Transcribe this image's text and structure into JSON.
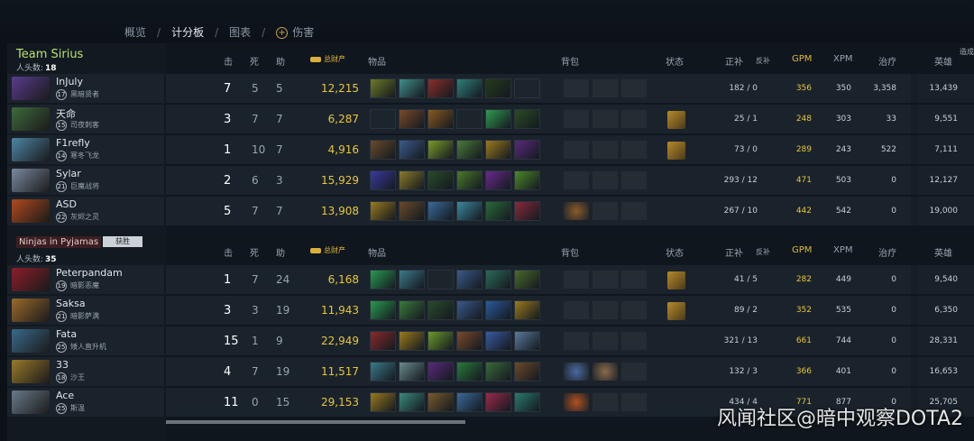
{
  "nav": {
    "tabs": [
      "概览",
      "计分板",
      "图表",
      "伤害"
    ],
    "active": "计分板",
    "sep": "/"
  },
  "headers": {
    "kills": "击",
    "deaths": "死",
    "assists": "助",
    "networth": "总财产",
    "items": "物品",
    "backpack": "背包",
    "status": "状态",
    "lasthits": "正补",
    "denies": "反补",
    "gpm": "GPM",
    "xpm": "XPM",
    "heal": "治疗",
    "hero_damage": "英雄",
    "edge": "造成"
  },
  "teams": [
    {
      "name": "Team Sirius",
      "kills_label": "人头数:",
      "kills": "18",
      "result": "",
      "players": [
        {
          "name": "InJuly",
          "level": "17",
          "hero": "黑暗贤者",
          "k": "7",
          "d": "5",
          "a": "5",
          "nw": "12,215",
          "lh": "182",
          "dn": "0",
          "gpm": "356",
          "xpm": "350",
          "heal": "3,358",
          "hd": "13,439",
          "portrait": "#5b3c8e",
          "items": [
            "#6d7a25",
            "#3f8f8a",
            "#8a2f2a",
            "#2e7f7a",
            "#243a1a",
            "empty"
          ],
          "backpack": [
            "empty",
            "empty",
            "empty"
          ],
          "neutral": ""
        },
        {
          "name": "天命",
          "level": "15",
          "hero": "司夜刺客",
          "k": "3",
          "d": "7",
          "a": "7",
          "nw": "6,287",
          "lh": "25",
          "dn": "1",
          "gpm": "248",
          "xpm": "303",
          "heal": "33",
          "hd": "9,551",
          "portrait": "#3f6a3d",
          "items": [
            "empty",
            "#7a4a2a",
            "#8a5a1e",
            "empty",
            "#2f9a4f",
            "#2b4a24"
          ],
          "backpack": [
            "empty",
            "empty",
            "empty"
          ],
          "neutral": "#b78a2a"
        },
        {
          "name": "F1refly",
          "level": "14",
          "hero": "寒冬飞龙",
          "k": "1",
          "d": "10",
          "a": "7",
          "nw": "4,916",
          "lh": "73",
          "dn": "0",
          "gpm": "289",
          "xpm": "243",
          "heal": "522",
          "hd": "7,111",
          "portrait": "#4d86a6",
          "items": [
            "#6a4a2a",
            "#3c5a8a",
            "#7a9a2a",
            "#4a7a3a",
            "#9a7a1e",
            "#5a2a7a"
          ],
          "backpack": [
            "empty",
            "empty",
            "empty"
          ],
          "neutral": "#b78a2a"
        },
        {
          "name": "Sylar",
          "level": "21",
          "hero": "巨魔战将",
          "k": "2",
          "d": "6",
          "a": "3",
          "nw": "15,929",
          "lh": "293",
          "dn": "12",
          "gpm": "471",
          "xpm": "503",
          "heal": "0",
          "hd": "12,127",
          "portrait": "#7a8aa0",
          "items": [
            "#3a3aa0",
            "#8a7a2a",
            "#2a4a2a",
            "#4a7a2a",
            "#6a2a8a",
            "#4a8a2a"
          ],
          "backpack": [
            "empty",
            "empty",
            "empty"
          ],
          "neutral": ""
        },
        {
          "name": "ASD",
          "level": "22",
          "hero": "灰烬之灵",
          "k": "5",
          "d": "7",
          "a": "7",
          "nw": "13,908",
          "lh": "267",
          "dn": "10",
          "gpm": "442",
          "xpm": "542",
          "heal": "0",
          "hd": "19,000",
          "portrait": "#b04a1e",
          "items": [
            "#9a7a1e",
            "#6a4a2a",
            "#3a6a9a",
            "#3a8aa0",
            "#2a6a3a",
            "#8a2a3a"
          ],
          "backpack": [
            "#8a5a2a",
            "empty",
            "empty"
          ],
          "neutral": ""
        }
      ]
    },
    {
      "name": "Ninjas in Pyjamas",
      "kills_label": "人头数:",
      "kills": "35",
      "result": "获胜",
      "players": [
        {
          "name": "Peterpandam",
          "level": "19",
          "hero": "暗影恶魔",
          "k": "1",
          "d": "7",
          "a": "24",
          "nw": "6,168",
          "lh": "41",
          "dn": "5",
          "gpm": "282",
          "xpm": "449",
          "heal": "0",
          "hd": "9,540",
          "portrait": "#8a1e2a",
          "items": [
            "#2a9a4f",
            "#3a7a8a",
            "empty",
            "#3a5a8a",
            "#2a6a5a",
            "#4a6a2a"
          ],
          "backpack": [
            "empty",
            "empty",
            "empty"
          ],
          "neutral": "#b78a2a"
        },
        {
          "name": "Saksa",
          "level": "21",
          "hero": "暗影萨满",
          "k": "3",
          "d": "3",
          "a": "19",
          "nw": "11,943",
          "lh": "89",
          "dn": "2",
          "gpm": "352",
          "xpm": "535",
          "heal": "0",
          "hd": "6,350",
          "portrait": "#9a6a2a",
          "items": [
            "#2a9a4f",
            "#3a7a3a",
            "#2a4a2a",
            "#3a5a8a",
            "#2a5a9a",
            "#9a7a1e"
          ],
          "backpack": [
            "empty",
            "empty",
            "empty"
          ],
          "neutral": "#b78a2a"
        },
        {
          "name": "Fata",
          "level": "25",
          "hero": "矮人直升机",
          "k": "15",
          "d": "1",
          "a": "9",
          "nw": "22,949",
          "lh": "321",
          "dn": "13",
          "gpm": "661",
          "xpm": "744",
          "heal": "0",
          "hd": "28,331",
          "portrait": "#3a6a8a",
          "items": [
            "#8a2a2a",
            "#9a7a1e",
            "#6a9a2a",
            "#7a4a2a",
            "#3a5aa0",
            "#5a7a9a"
          ],
          "backpack": [
            "empty",
            "empty",
            "empty"
          ],
          "neutral": ""
        },
        {
          "name": "33",
          "level": "18",
          "hero": "沙王",
          "k": "4",
          "d": "7",
          "a": "19",
          "nw": "11,517",
          "lh": "132",
          "dn": "3",
          "gpm": "366",
          "xpm": "401",
          "heal": "0",
          "hd": "16,653",
          "portrait": "#9a7a2a",
          "items": [
            "#3a7a8a",
            "#6a8a8a",
            "#5a2a7a",
            "#2a7a3a",
            "#3a6a3a",
            "#6a4a2a"
          ],
          "backpack": [
            "#4a6aa0",
            "#8a6a4a",
            "empty"
          ],
          "neutral": ""
        },
        {
          "name": "Ace",
          "level": "25",
          "hero": "斯温",
          "k": "11",
          "d": "0",
          "a": "15",
          "nw": "29,153",
          "lh": "434",
          "dn": "4",
          "gpm": "771",
          "xpm": "877",
          "heal": "0",
          "hd": "25,705",
          "portrait": "#6a7a8a",
          "items": [
            "#9a7a1e",
            "#3a8a7a",
            "#7a5a2a",
            "#3a6a9a",
            "#9a2a4a",
            "#2a7a6a"
          ],
          "backpack": [
            "#b0501e",
            "empty",
            "empty"
          ],
          "neutral": ""
        }
      ]
    }
  ],
  "watermark": "风闻社区@暗中观察DOTA2"
}
